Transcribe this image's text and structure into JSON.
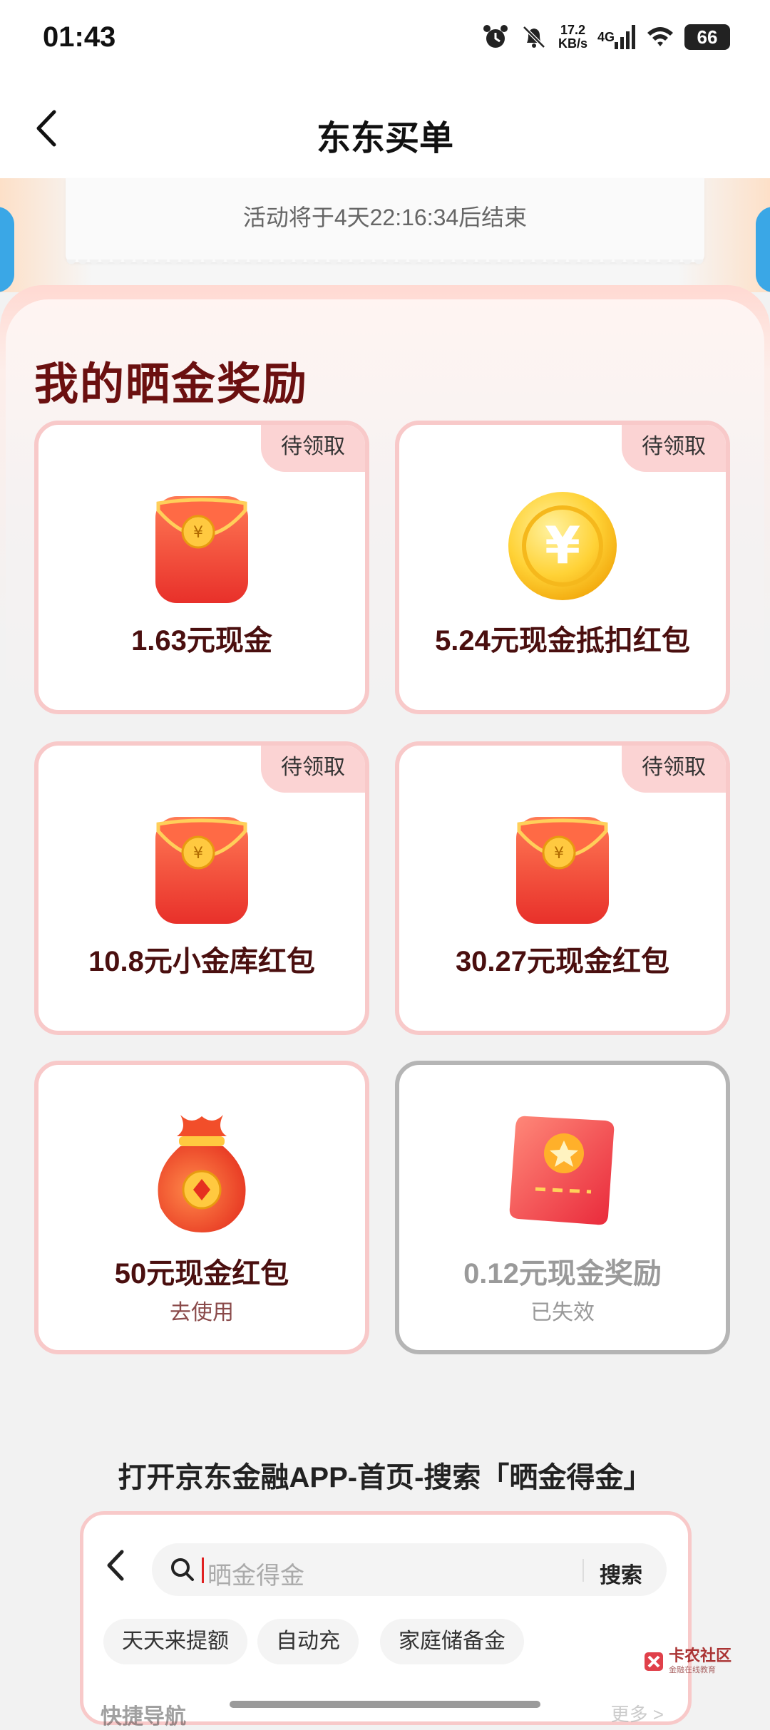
{
  "status_bar": {
    "time": "01:43",
    "net_speed_value": "17.2",
    "net_speed_unit": "KB/s",
    "network_type": "4G",
    "battery": "66"
  },
  "nav": {
    "title": "东东买单"
  },
  "banner": {
    "countdown": "活动将于4天22:16:34后结束"
  },
  "rewards": {
    "title": "我的晒金奖励",
    "items": [
      {
        "label": "1.63元现金",
        "tag": "待领取",
        "icon": "red-envelope-icon"
      },
      {
        "label": "5.24元现金抵扣红包",
        "tag": "待领取",
        "icon": "gold-coin-icon"
      },
      {
        "label": "10.8元小金库红包",
        "tag": "待领取",
        "icon": "red-envelope-icon"
      },
      {
        "label": "30.27元现金红包",
        "tag": "待领取",
        "icon": "red-envelope-icon"
      },
      {
        "label": "50元现金红包",
        "sub": "去使用",
        "icon": "lucky-bag-icon"
      },
      {
        "label": "0.12元现金奖励",
        "sub": "已失效",
        "icon": "coupon-star-icon"
      }
    ]
  },
  "guide": {
    "instruction": "打开京东金融APP-首页-搜索「晒金得金」",
    "search_placeholder": "晒金得金",
    "search_button": "搜索",
    "chips": [
      "天天来提额",
      "自动充",
      "家庭储备金"
    ],
    "quick_nav": "快捷导航",
    "more": "更多 >"
  },
  "watermark": {
    "text": "卡农社区",
    "sub": "金融在线教育"
  },
  "colors": {
    "accent_red": "#e8412f",
    "card_border": "#f8c9c9",
    "title_text": "#6b1010"
  }
}
